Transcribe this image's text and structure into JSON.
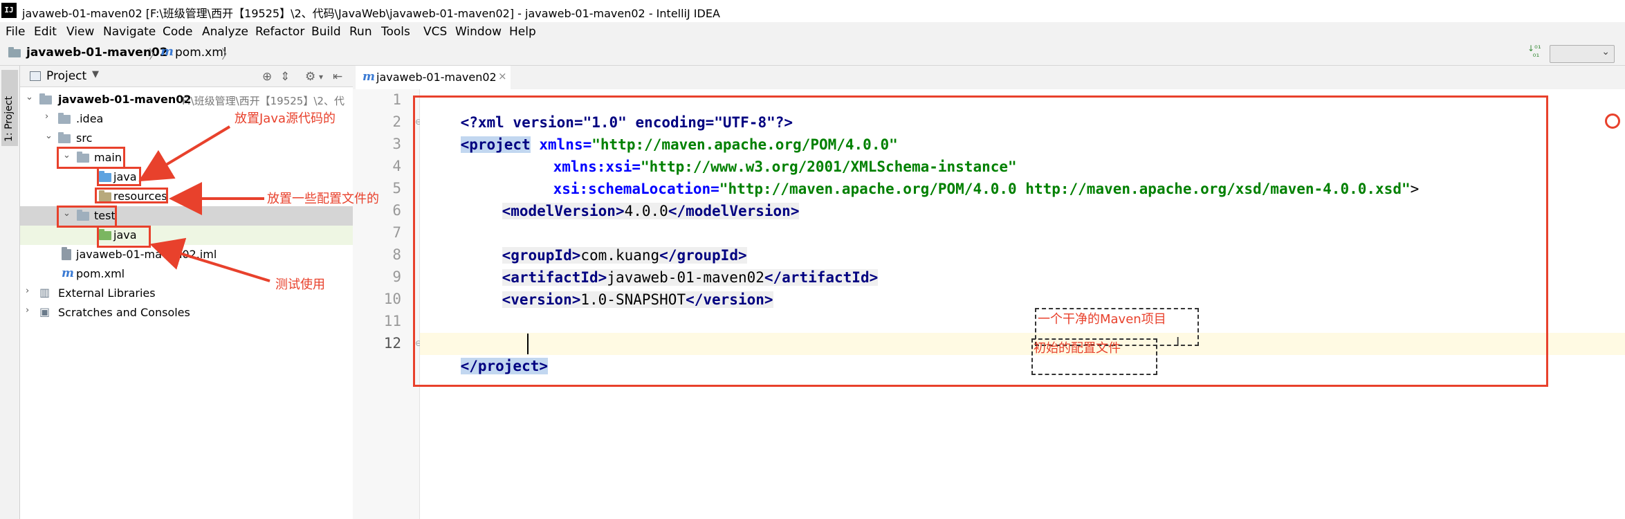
{
  "window": {
    "title": "javaweb-01-maven02 [F:\\班级管理\\西开【19525】\\2、代码\\JavaWeb\\javaweb-01-maven02] - javaweb-01-maven02 - IntelliJ IDEA",
    "logo": "IJ"
  },
  "menu": [
    "File",
    "Edit",
    "View",
    "Navigate",
    "Code",
    "Analyze",
    "Refactor",
    "Build",
    "Run",
    "Tools",
    "VCS",
    "Window",
    "Help"
  ],
  "navbar": {
    "project": "javaweb-01-maven02",
    "file": "pom.xml"
  },
  "toolstrip": {
    "project_tab": "1: Project"
  },
  "project_panel": {
    "header": "Project",
    "tree": [
      {
        "name": "javaweb-01-maven02",
        "extra": "F:\\班级管理\\西开【19525】\\2、代"
      },
      {
        "name": ".idea"
      },
      {
        "name": "src"
      },
      {
        "name": "main"
      },
      {
        "name": "java"
      },
      {
        "name": "resources"
      },
      {
        "name": "test"
      },
      {
        "name": "java"
      },
      {
        "name": "javaweb-01-maven02.iml"
      },
      {
        "name": "pom.xml"
      },
      {
        "name": "External Libraries"
      },
      {
        "name": "Scratches and Consoles"
      }
    ]
  },
  "editor": {
    "tab": "javaweb-01-maven02",
    "line_numbers": [
      "1",
      "2",
      "3",
      "4",
      "5",
      "6",
      "7",
      "8",
      "9",
      "10",
      "11",
      "12"
    ],
    "lines": {
      "l1": "<?xml version=\"1.0\" encoding=\"UTF-8\"?>",
      "l2_tag": "<project",
      "l2_attr": " xmlns=",
      "l2_val": "\"http://maven.apache.org/POM/4.0.0\"",
      "l3_attr": "xmlns:xsi=",
      "l3_val": "\"http://www.w3.org/2001/XMLSchema-instance\"",
      "l4_attr": "xsi:schemaLocation=",
      "l4_val": "\"http://maven.apache.org/POM/4.0.0 http://maven.apache.org/xsd/maven-4.0.0.xsd\"",
      "l4_end": ">",
      "l5_open": "<modelVersion>",
      "l5_text": "4.0.0",
      "l5_close": "</modelVersion>",
      "l7_open": "<groupId>",
      "l7_text": "com.kuang",
      "l7_close": "</groupId>",
      "l8_open": "<artifactId>",
      "l8_text": "javaweb-01-maven02",
      "l8_close": "</artifactId>",
      "l9_open": "<version>",
      "l9_text": "1.0-SNAPSHOT",
      "l9_close": "</version>",
      "l12": "</project>"
    }
  },
  "annotations": {
    "java_src": "放置Java源代码的",
    "config": "放置一些配置文件的",
    "test": "测试使用",
    "clean_project": "一个干净的Maven项目",
    "init_config": "初始的配置文件"
  },
  "colors": {
    "annotation_red": "#e8412c",
    "tag_blue": "#000080",
    "attr_blue": "#0000ff",
    "string_green": "#008000"
  }
}
